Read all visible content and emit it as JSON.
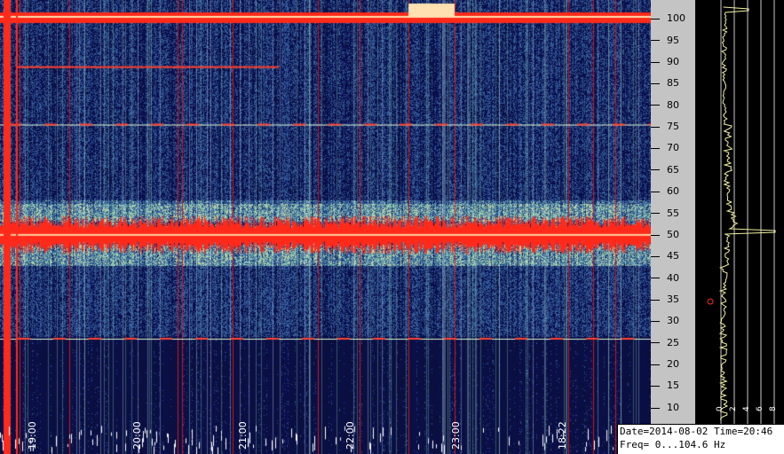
{
  "spectrogram": {
    "date_label": "Date=2014-08-02",
    "time_label": "Time=20:46",
    "freq_label": "Freq= 0...104.6 Hz",
    "time_labels": [
      "19:00",
      "20:00",
      "21:00",
      "22:00",
      "23:00",
      "18:22"
    ],
    "freq_ticks": [
      "100",
      "95",
      "90",
      "85",
      "80",
      "75",
      "70",
      "65",
      "60",
      "55",
      "50",
      "45",
      "40",
      "35",
      "30",
      "25",
      "20",
      "15",
      "10"
    ],
    "amplitude_ticks": [
      "0",
      "2",
      "4",
      "6",
      "8"
    ],
    "freq_range_hz": [
      0,
      104.6
    ],
    "strong_lines_hz": [
      50,
      100
    ],
    "weak_lines_hz": [
      26,
      75.5
    ],
    "colors": {
      "background": "#0b0f22",
      "noise_low": "#1a2a6e",
      "noise_high": "#7fd0a0",
      "signal": "#ff2a1a",
      "axis_panel": "#c4c4c4",
      "spectrum_trace": "#f0f0a0"
    }
  }
}
